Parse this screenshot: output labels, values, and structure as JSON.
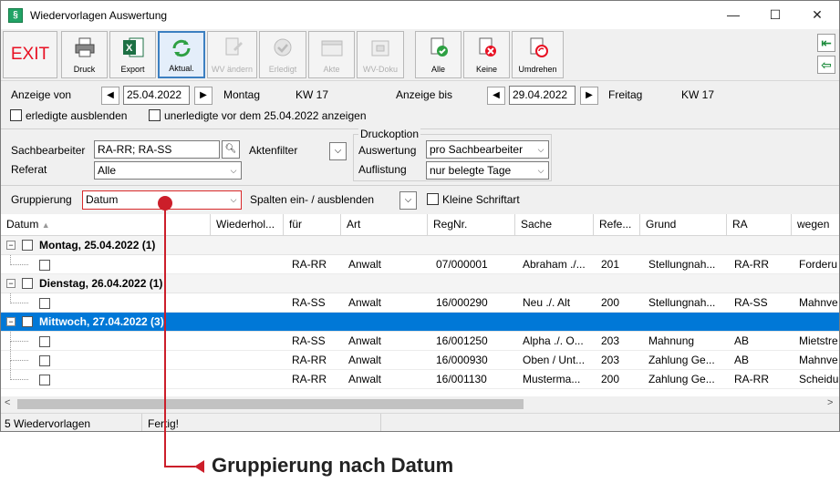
{
  "window": {
    "title": "Wiedervorlagen Auswertung",
    "app_icon": "§"
  },
  "toolbar": {
    "exit": "EXIT",
    "druck": "Druck",
    "export": "Export",
    "aktual": "Aktual.",
    "wvaendern": "WV ändern",
    "erledigt": "Erledigt",
    "akte": "Akte",
    "wvdoku": "WV-Doku",
    "alle": "Alle",
    "keine": "Keine",
    "umdrehen": "Umdrehen"
  },
  "range": {
    "von_label": "Anzeige von",
    "von_date": "25.04.2022",
    "von_day": "Montag",
    "von_kw": "KW 17",
    "bis_label": "Anzeige bis",
    "bis_date": "29.04.2022",
    "bis_day": "Freitag",
    "bis_kw": "KW 17",
    "erledigte": "erledigte ausblenden",
    "unerledigte": "unerledigte vor dem 25.04.2022 anzeigen"
  },
  "filter": {
    "sachbearbeiter_label": "Sachbearbeiter",
    "sachbearbeiter_value": "RA-RR; RA-SS",
    "referat_label": "Referat",
    "referat_value": "Alle",
    "aktenfilter_label": "Aktenfilter",
    "druckoption_label": "Druckoption",
    "auswertung_label": "Auswertung",
    "auswertung_value": "pro Sachbearbeiter",
    "auflistung_label": "Auflistung",
    "auflistung_value": "nur belegte Tage"
  },
  "grouping": {
    "label": "Gruppierung",
    "value": "Datum",
    "spalten_label": "Spalten ein- / ausblenden",
    "kleine_label": "Kleine Schriftart"
  },
  "grid": {
    "columns": [
      "Datum",
      "Wiederhol...",
      "für",
      "Art",
      "RegNr.",
      "Sache",
      "Refe...",
      "Grund",
      "RA",
      "wegen"
    ],
    "groups": [
      {
        "label": "Montag, 25.04.2022 (1)",
        "rows": [
          [
            "RA-RR",
            "Anwalt",
            "07/000001",
            "Abraham ./...",
            "201",
            "Stellungnah...",
            "RA-RR",
            "Forderu"
          ]
        ]
      },
      {
        "label": "Dienstag, 26.04.2022 (1)",
        "rows": [
          [
            "RA-SS",
            "Anwalt",
            "16/000290",
            "Neu ./. Alt",
            "200",
            "Stellungnah...",
            "RA-SS",
            "Mahnve"
          ]
        ]
      },
      {
        "label": "Mittwoch, 27.04.2022 (3)",
        "rows": [
          [
            "RA-SS",
            "Anwalt",
            "16/001250",
            "Alpha ./. O...",
            "203",
            "Mahnung",
            "AB",
            "Mietstre"
          ],
          [
            "RA-RR",
            "Anwalt",
            "16/000930",
            "Oben / Unt...",
            "203",
            "Zahlung Ge...",
            "AB",
            "Mahnve"
          ],
          [
            "RA-RR",
            "Anwalt",
            "16/001130",
            "Musterma...",
            "200",
            "Zahlung Ge...",
            "RA-RR",
            "Scheidu"
          ]
        ]
      }
    ]
  },
  "status": {
    "count": "5 Wiedervorlagen",
    "state": "Fertig!"
  },
  "caption": "Gruppierung nach Datum",
  "colors": {
    "selection": "#0078d7",
    "exit": "#e81123",
    "annotation": "#cc1e2a"
  }
}
